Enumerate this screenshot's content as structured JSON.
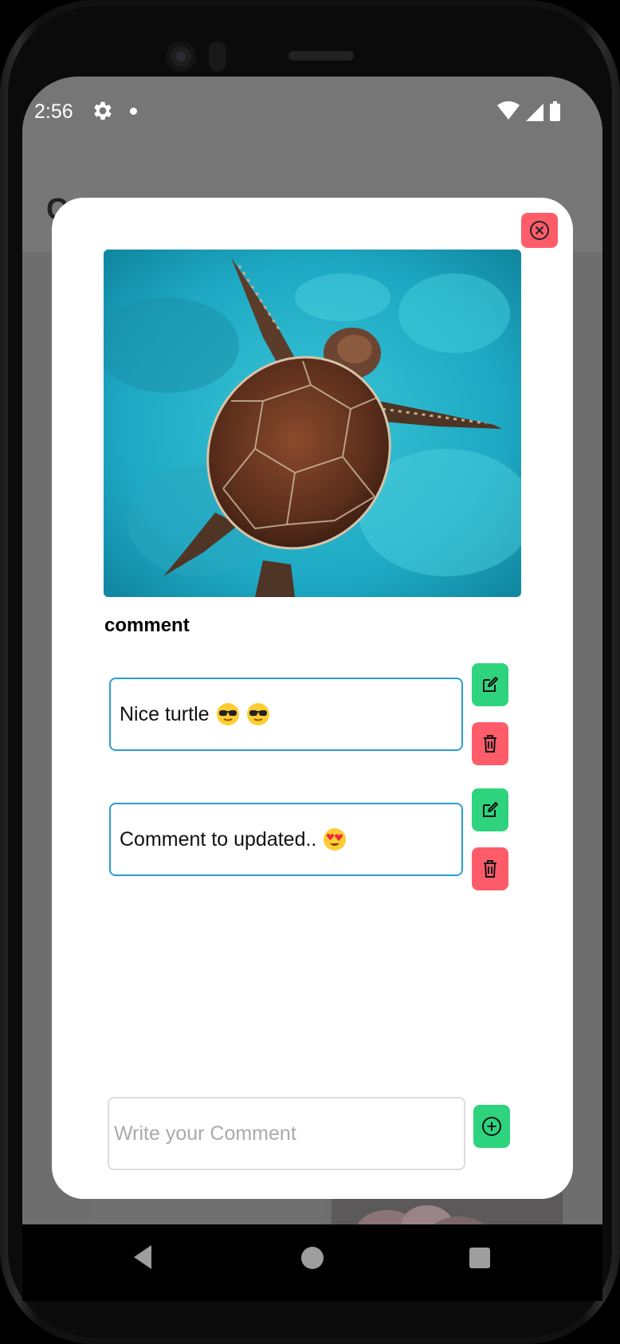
{
  "status_bar": {
    "time": "2:56"
  },
  "app_bar": {
    "title_fragment": "C"
  },
  "modal": {
    "section_label": "comment",
    "comments": [
      {
        "text": "Nice turtle",
        "emojis": [
          "sunglasses-face-emoji",
          "sunglasses-face-emoji"
        ]
      },
      {
        "text": "Comment to updated..",
        "emojis": [
          "heart-eyes-face-emoji"
        ]
      }
    ],
    "input": {
      "value": "",
      "placeholder": "Write your Comment"
    }
  },
  "colors": {
    "accent_green": "#2ed47d",
    "accent_red": "#ff5c6a",
    "input_border": "#2a9fd1"
  },
  "icons": {
    "close": "close-circle-icon",
    "edit": "edit-icon",
    "delete": "trash-icon",
    "add": "plus-circle-icon"
  }
}
